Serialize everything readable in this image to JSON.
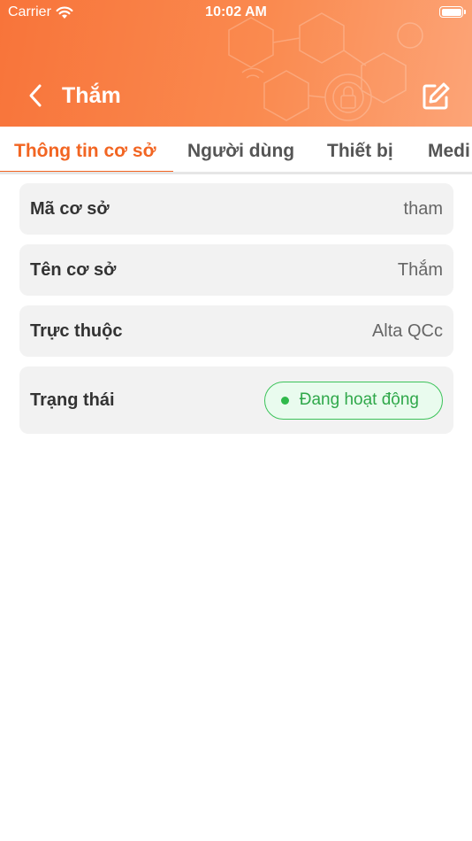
{
  "status_bar": {
    "carrier": "Carrier",
    "time": "10:02 AM"
  },
  "header": {
    "title": "Thắm"
  },
  "tabs": [
    {
      "label": "Thông tin cơ sở",
      "active": true
    },
    {
      "label": "Người dùng",
      "active": false
    },
    {
      "label": "Thiết bị",
      "active": false
    },
    {
      "label": "Medi",
      "active": false
    }
  ],
  "info": {
    "code": {
      "label": "Mã cơ sở",
      "value": "tham"
    },
    "name": {
      "label": "Tên cơ sở",
      "value": "Thắm"
    },
    "parent": {
      "label": "Trực thuộc",
      "value": "Alta QCc"
    },
    "status": {
      "label": "Trạng thái",
      "value": "Đang hoạt động"
    }
  },
  "colors": {
    "header_start": "#f8743a",
    "header_end": "#fca477",
    "accent": "#f26522",
    "status_active": "#2fa84a"
  },
  "icons": {
    "back": "chevron-left-icon",
    "edit": "edit-icon",
    "wifi": "wifi-icon",
    "battery": "battery-icon"
  }
}
